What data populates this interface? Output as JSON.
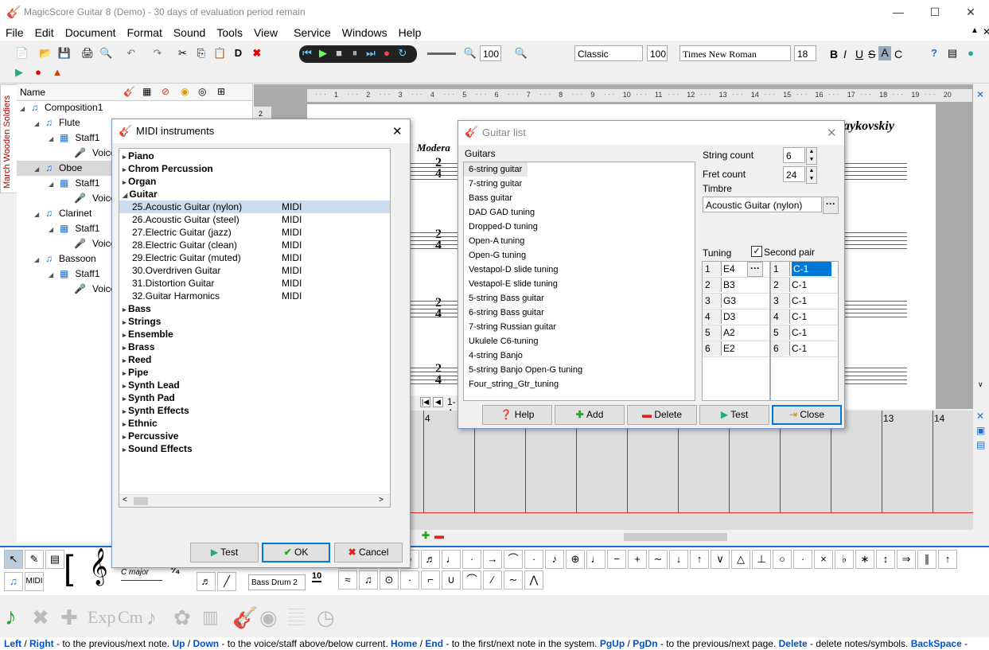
{
  "window": {
    "title": "MagicScore Guitar 8 (Demo) - 30 days of evaluation period remain"
  },
  "menu": [
    "File",
    "Edit",
    "Document",
    "Format",
    "Sound",
    "Tools",
    "View",
    "Service",
    "Windows",
    "Help"
  ],
  "toolbar": {
    "zoom": "100",
    "style": "Classic",
    "style_size": "100",
    "font": "Times New Roman",
    "font_size": "18",
    "bold": "B",
    "italic": "I",
    "underline": "U",
    "strike": "S",
    "a_label": "A",
    "c_label": "C",
    "d_label": "D"
  },
  "side_tab": {
    "label": "March Wooden Soldiers"
  },
  "tree": {
    "header": "Name",
    "rows": [
      {
        "label": "Composition1",
        "indent": 0
      },
      {
        "label": "Flute",
        "indent": 1
      },
      {
        "label": "Staff1",
        "indent": 2
      },
      {
        "label": "Voice1",
        "indent": 3
      },
      {
        "label": "Oboe",
        "indent": 1,
        "selected": true
      },
      {
        "label": "Staff1",
        "indent": 2
      },
      {
        "label": "Voice1",
        "indent": 3
      },
      {
        "label": "Clarinet",
        "indent": 1
      },
      {
        "label": "Staff1",
        "indent": 2
      },
      {
        "label": "Voice1",
        "indent": 3
      },
      {
        "label": "Bassoon",
        "indent": 1
      },
      {
        "label": "Staff1",
        "indent": 2
      },
      {
        "label": "Voice1",
        "indent": 3
      }
    ]
  },
  "ruler": {
    "marks": [
      "1",
      "2",
      "3",
      "4",
      "5",
      "6",
      "7",
      "8",
      "9",
      "10",
      "11",
      "12",
      "13",
      "14",
      "15",
      "16",
      "17",
      "18",
      "19",
      "20"
    ]
  },
  "score": {
    "composer": "aykovskiy",
    "tempo": "Modera",
    "time_top": "2",
    "time_bottom": "4",
    "page_indicator": "1-4",
    "measures": [
      "4",
      "13",
      "14"
    ],
    "row_numbers": [
      "2"
    ]
  },
  "midi_dialog": {
    "title": "MIDI instruments",
    "categories_top": [
      "Piano",
      "Chrom Percussion",
      "Organ"
    ],
    "open_category": "Guitar",
    "instruments": [
      {
        "name": "25.Acoustic Guitar (nylon)",
        "type": "MIDI",
        "selected": true
      },
      {
        "name": "26.Acoustic Guitar (steel)",
        "type": "MIDI"
      },
      {
        "name": "27.Electric Guitar (jazz)",
        "type": "MIDI"
      },
      {
        "name": "28.Electric Guitar (clean)",
        "type": "MIDI"
      },
      {
        "name": "29.Electric Guitar (muted)",
        "type": "MIDI"
      },
      {
        "name": "30.Overdriven Guitar",
        "type": "MIDI"
      },
      {
        "name": "31.Distortion Guitar",
        "type": "MIDI"
      },
      {
        "name": "32.Guitar Harmonics",
        "type": "MIDI"
      }
    ],
    "categories_bottom": [
      "Bass",
      "Strings",
      "Ensemble",
      "Brass",
      "Reed",
      "Pipe",
      "Synth Lead",
      "Synth Pad",
      "Synth Effects",
      "Ethnic",
      "Percussive",
      "Sound Effects"
    ],
    "buttons": {
      "test": "Test",
      "ok": "OK",
      "cancel": "Cancel"
    }
  },
  "guitar_dialog": {
    "title": "Guitar list",
    "guitars_label": "Guitars",
    "guitars": [
      "6-string guitar",
      "7-string guitar",
      "Bass guitar",
      "DAD GAD tuning",
      "Dropped-D tuning",
      "Open-A tuning",
      "Open-G tuning",
      "Vestapol-D slide tuning",
      "Vestapol-E slide tuning",
      "5-string Bass guitar",
      "6-string Bass guitar",
      "7-string Russian guitar",
      "Ukulele C6-tuning",
      "4-string Banjo",
      "5-string Banjo Open-G tuning",
      "Four_string_Gtr_tuning"
    ],
    "string_count_label": "String count",
    "string_count": "6",
    "fret_count_label": "Fret count",
    "fret_count": "24",
    "timbre_label": "Timbre",
    "timbre": "Acoustic Guitar (nylon)",
    "tuning_label": "Tuning",
    "second_pair_label": "Second pair",
    "tuning": [
      {
        "n": "1",
        "note": "E4"
      },
      {
        "n": "2",
        "note": "B3"
      },
      {
        "n": "3",
        "note": "G3"
      },
      {
        "n": "4",
        "note": "D3"
      },
      {
        "n": "5",
        "note": "A2"
      },
      {
        "n": "6",
        "note": "E2"
      }
    ],
    "second_pair": [
      {
        "n": "1",
        "note": "C-1"
      },
      {
        "n": "2",
        "note": "C-1"
      },
      {
        "n": "3",
        "note": "C-1"
      },
      {
        "n": "4",
        "note": "C-1"
      },
      {
        "n": "5",
        "note": "C-1"
      },
      {
        "n": "6",
        "note": "C-1"
      }
    ],
    "buttons": {
      "help": "Help",
      "add": "Add",
      "delete": "Delete",
      "test": "Test",
      "close": "Close"
    }
  },
  "palette": {
    "key": "C major",
    "drum": "Bass Drum 2",
    "midi": "MIDI",
    "ten": "10"
  },
  "status": [
    {
      "k": "Left",
      "t": " / "
    },
    {
      "k": "Right",
      "t": " - to the previous/next note. "
    },
    {
      "k": "Up",
      "t": " / "
    },
    {
      "k": "Down",
      "t": " - to the voice/staff above/below current. "
    },
    {
      "k": "Home",
      "t": " / "
    },
    {
      "k": "End",
      "t": " - to the first/next note in the system. "
    },
    {
      "k": "PgUp",
      "t": " / "
    },
    {
      "k": "PgDn",
      "t": " - to the previous/next page. "
    },
    {
      "k": "Delete",
      "t": " - delete notes/symbols. "
    },
    {
      "k": "BackSpace",
      "t": " - "
    }
  ]
}
